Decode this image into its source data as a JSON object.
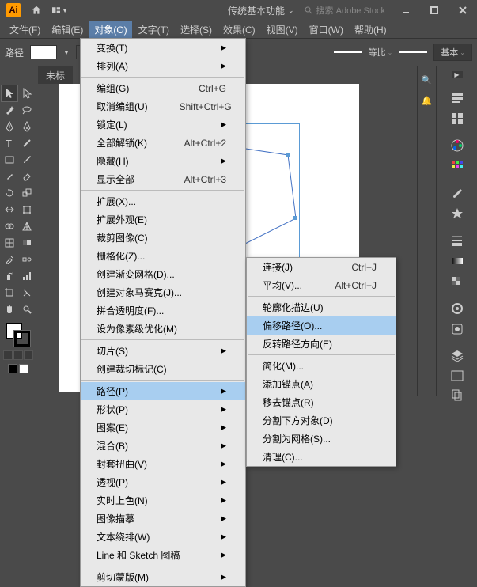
{
  "title": {
    "workspace": "传统基本功能",
    "search_placeholder": "搜索 Adobe Stock"
  },
  "menubar": [
    "文件(F)",
    "编辑(E)",
    "对象(O)",
    "文字(T)",
    "选择(S)",
    "效果(C)",
    "视图(V)",
    "窗口(W)",
    "帮助(H)"
  ],
  "controlbar": {
    "path_label": "路径",
    "stroke_mode": "等比",
    "basic_label": "基本"
  },
  "tab": {
    "name": "未标"
  },
  "menu_object": [
    {
      "l": "变换(T)",
      "sub": true
    },
    {
      "l": "排列(A)",
      "sub": true
    },
    {
      "sep": true
    },
    {
      "l": "编组(G)",
      "sc": "Ctrl+G"
    },
    {
      "l": "取消编组(U)",
      "sc": "Shift+Ctrl+G"
    },
    {
      "l": "锁定(L)",
      "sub": true
    },
    {
      "l": "全部解锁(K)",
      "sc": "Alt+Ctrl+2"
    },
    {
      "l": "隐藏(H)",
      "sub": true
    },
    {
      "l": "显示全部",
      "sc": "Alt+Ctrl+3"
    },
    {
      "sep": true
    },
    {
      "l": "扩展(X)..."
    },
    {
      "l": "扩展外观(E)"
    },
    {
      "l": "裁剪图像(C)"
    },
    {
      "l": "栅格化(Z)..."
    },
    {
      "l": "创建渐变网格(D)..."
    },
    {
      "l": "创建对象马赛克(J)..."
    },
    {
      "l": "拼合透明度(F)..."
    },
    {
      "l": "设为像素级优化(M)"
    },
    {
      "sep": true
    },
    {
      "l": "切片(S)",
      "sub": true
    },
    {
      "l": "创建裁切标记(C)"
    },
    {
      "sep": true
    },
    {
      "l": "路径(P)",
      "sub": true,
      "hl": true
    },
    {
      "l": "形状(P)",
      "sub": true
    },
    {
      "l": "图案(E)",
      "sub": true
    },
    {
      "l": "混合(B)",
      "sub": true
    },
    {
      "l": "封套扭曲(V)",
      "sub": true
    },
    {
      "l": "透视(P)",
      "sub": true
    },
    {
      "l": "实时上色(N)",
      "sub": true
    },
    {
      "l": "图像描摹",
      "sub": true
    },
    {
      "l": "文本绕排(W)",
      "sub": true
    },
    {
      "l": "Line 和 Sketch 图稿",
      "sub": true
    },
    {
      "sep": true
    },
    {
      "l": "剪切蒙版(M)",
      "sub": true
    }
  ],
  "menu_path": [
    {
      "l": "连接(J)",
      "sc": "Ctrl+J"
    },
    {
      "l": "平均(V)...",
      "sc": "Alt+Ctrl+J"
    },
    {
      "sep": true
    },
    {
      "l": "轮廓化描边(U)"
    },
    {
      "l": "偏移路径(O)...",
      "hl": true
    },
    {
      "l": "反转路径方向(E)"
    },
    {
      "sep": true
    },
    {
      "l": "简化(M)..."
    },
    {
      "l": "添加锚点(A)"
    },
    {
      "l": "移去锚点(R)"
    },
    {
      "l": "分割下方对象(D)"
    },
    {
      "l": "分割为网格(S)..."
    },
    {
      "l": "清理(C)..."
    }
  ]
}
